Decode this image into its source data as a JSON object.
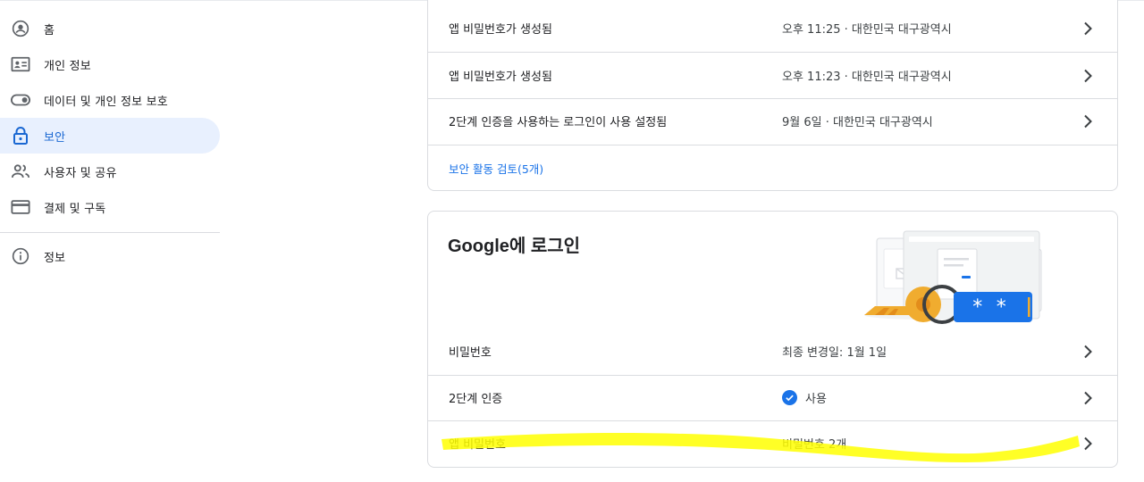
{
  "sidebar": {
    "items": [
      {
        "label": "홈",
        "icon": "account-circle-icon"
      },
      {
        "label": "개인 정보",
        "icon": "id-card-icon"
      },
      {
        "label": "데이터 및 개인 정보 보호",
        "icon": "toggle-icon"
      },
      {
        "label": "보안",
        "icon": "lock-icon",
        "active": true
      },
      {
        "label": "사용자 및 공유",
        "icon": "people-icon"
      },
      {
        "label": "결제 및 구독",
        "icon": "credit-card-icon"
      }
    ],
    "info": {
      "label": "정보",
      "icon": "info-icon"
    }
  },
  "activity": {
    "rows": [
      {
        "label": "앱 비밀번호가 생성됨",
        "value": "오후 11:25 · 대한민국 대구광역시"
      },
      {
        "label": "앱 비밀번호가 생성됨",
        "value": "오후 11:23 · 대한민국 대구광역시"
      },
      {
        "label": "2단계 인증을 사용하는 로그인이 사용 설정됨",
        "value": "9월 6일 · 대한민국 대구광역시"
      }
    ],
    "review_link": "보안 활동 검토(5개)"
  },
  "signin": {
    "title": "Google에 로그인",
    "rows": [
      {
        "label": "비밀번호",
        "value": "최종 변경일: 1월 1일"
      },
      {
        "label": "2단계 인증",
        "value": "사용"
      },
      {
        "label": "앱 비밀번호",
        "value": "비밀번호 2개"
      }
    ],
    "password_dots": "* *"
  },
  "colors": {
    "accent": "#1a73e8",
    "active_bg": "#e8f0fe",
    "highlight": "#ffff00",
    "key": "#f0ac2f"
  }
}
